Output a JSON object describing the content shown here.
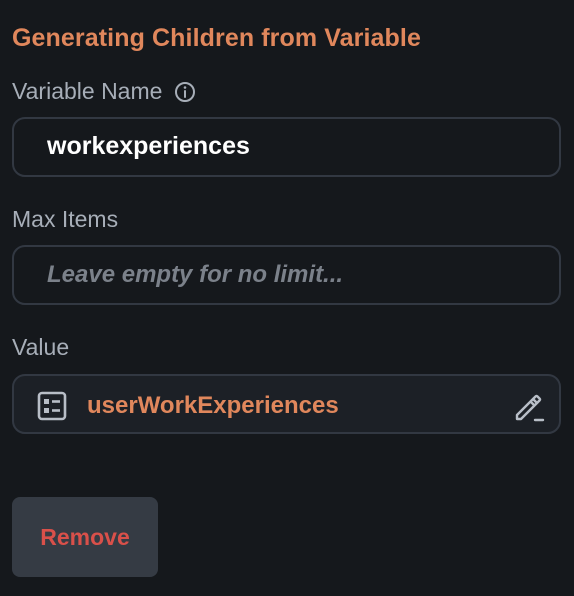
{
  "panel": {
    "title": "Generating Children from Variable",
    "accent_color": "#e0875c",
    "danger_color": "#d9504a"
  },
  "variable_name": {
    "label": "Variable Name",
    "info_icon": "info-circle-icon",
    "value": "workexperiences"
  },
  "max_items": {
    "label": "Max Items",
    "value": "",
    "placeholder": "Leave empty for no limit..."
  },
  "value_field": {
    "label": "Value",
    "type_icon": "list-document-icon",
    "value": "userWorkExperiences",
    "edit_icon": "pencil-edit-icon"
  },
  "actions": {
    "remove_label": "Remove"
  }
}
